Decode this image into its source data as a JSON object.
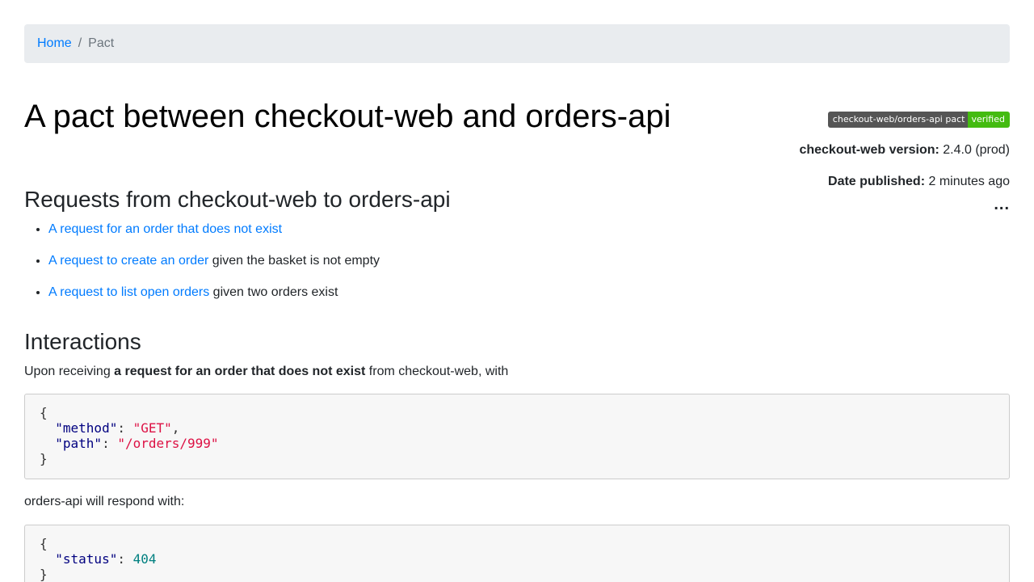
{
  "breadcrumb": {
    "home": "Home",
    "separator": "/",
    "current": "Pact"
  },
  "title": "A pact between checkout-web and orders-api",
  "badge": {
    "left": "checkout-web/orders-api pact",
    "right": "verified",
    "left_color": "#555555",
    "right_color": "#44bb11"
  },
  "meta": {
    "version_label": "checkout-web version:",
    "version_value": "2.4.0 (prod)",
    "published_label": "Date published:",
    "published_value": "2 minutes ago",
    "more_label": "..."
  },
  "requests": {
    "heading": "Requests from checkout-web to orders-api",
    "items": [
      {
        "link": "A request for an order that does not exist",
        "suffix": ""
      },
      {
        "link": "A request to create an order",
        "suffix": " given the basket is not empty"
      },
      {
        "link": "A request to list open orders",
        "suffix": " given two orders exist"
      }
    ]
  },
  "interactions": {
    "heading": "Interactions",
    "intro_prefix": "Upon receiving ",
    "intro_bold": "a request for an order that does not exist",
    "intro_suffix": " from checkout-web, with",
    "request": {
      "open": "{",
      "method_key": "\"method\"",
      "method_value": "\"GET\"",
      "path_key": "\"path\"",
      "path_value": "\"/orders/999\"",
      "close": "}"
    },
    "respond_text": "orders-api will respond with:",
    "response": {
      "open": "{",
      "status_key": "\"status\"",
      "status_value": "404",
      "close": "}"
    }
  }
}
